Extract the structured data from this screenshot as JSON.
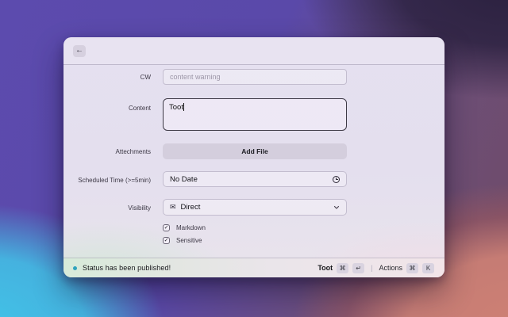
{
  "window": {
    "titlebar": {
      "back_icon": "←"
    },
    "form": {
      "cw_label": "CW",
      "cw_placeholder": "content warning",
      "content_label": "Content",
      "content_value": "Toot",
      "attachments_label": "Attechments",
      "add_file_button": "Add File",
      "scheduled_label": "Scheduled Time (>=5min)",
      "scheduled_value": "No Date",
      "visibility_label": "Visibility",
      "visibility_value": "Direct",
      "visibility_icon": "✉",
      "checkboxes": [
        {
          "label": "Markdown",
          "checked": true,
          "check_glyph": "✓"
        },
        {
          "label": "Sensitive",
          "checked": true,
          "check_glyph": "✓"
        }
      ]
    },
    "statusbar": {
      "status_message": "Status has been published!",
      "toot_label": "Toot",
      "toot_key_1": "⌘",
      "toot_key_2": "↵",
      "separator": "|",
      "actions_label": "Actions",
      "actions_key_1": "⌘",
      "actions_key_2": "K"
    }
  },
  "colors": {
    "status_dot": "#2fa3bd",
    "bg_purple": "#5c4bae",
    "bg_dark_purple": "#2b2140",
    "bg_cyan": "#41c4e8",
    "bg_salmon": "#cf8175",
    "statusbar_green": "#d7ebd9",
    "content_border": "#3e3a46"
  }
}
